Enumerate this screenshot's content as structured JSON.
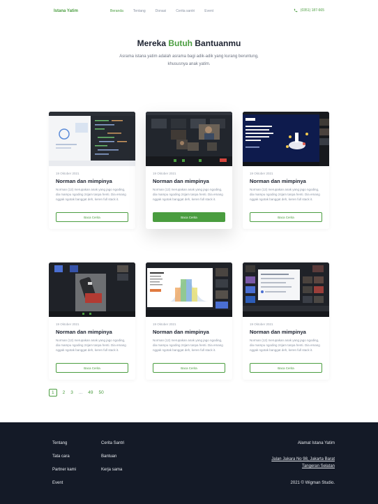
{
  "nav": {
    "brand": "Istana Yatim",
    "items": [
      {
        "label": "Beranda",
        "active": true
      },
      {
        "label": "Tentang",
        "active": false
      },
      {
        "label": "Donasi",
        "active": false
      },
      {
        "label": "Cerita santri",
        "active": false
      },
      {
        "label": "Event",
        "active": false
      }
    ],
    "phone_icon": "phone-icon",
    "phone": "(0351) 187-665"
  },
  "hero": {
    "title_pre": "Mereka",
    "title_accent": "Butuh",
    "title_post": "Bantuanmu",
    "description": "Asrama istana yatim adalah asrama bagi adik-adik yang kurang beruntung, khususnya anak yatim."
  },
  "cards": [
    {
      "date": "19 Oktober 2021",
      "title": "Norman dan mimpinya",
      "text": "Norman (12) merupakan anak yang jago ngoding, dia mampu ngoding 24jam tanpa henti. Dia emang nggak ngotak banggat deh, keren full stack it.",
      "button": "Baca Cerita",
      "primary": false,
      "image": "code-editor-screenshot"
    },
    {
      "date": "19 Oktober 2021",
      "title": "Norman dan mimpinya",
      "text": "Norman (12) merupakan anak yang jago ngoding, dia mampu ngoding 24jam tanpa henti. Dia emang nggak ngotak banggat deh, keren full stack it.",
      "button": "Baca Cerita",
      "primary": true,
      "image": "video-call-screenshot"
    },
    {
      "date": "19 Oktober 2021",
      "title": "Norman dan mimpinya",
      "text": "Norman (12) merupakan anak yang jago ngoding, dia mampu ngoding 24jam tanpa henti. Dia emang nggak ngotak banggat deh, keren full stack it.",
      "button": "Baca Cerita",
      "primary": false,
      "image": "presentation-slide-screenshot"
    },
    {
      "date": "19 Oktober 2021",
      "title": "Norman dan mimpinya",
      "text": "Norman (12) merupakan anak yang jago ngoding, dia mampu ngoding 24jam tanpa henti. Dia emang nggak ngotak banggat deh, keren full stack it.",
      "button": "Baca Cerita",
      "primary": false,
      "image": "video-call-device-screenshot"
    },
    {
      "date": "19 Oktober 2021",
      "title": "Norman dan mimpinya",
      "text": "Norman (12) merupakan anak yang jago ngoding, dia mampu ngoding 24jam tanpa henti. Dia emang nggak ngotak banggat deh, keren full stack it.",
      "button": "Baca Cerita",
      "primary": false,
      "image": "slide-share-screenshot"
    },
    {
      "date": "19 Oktober 2021",
      "title": "Norman dan mimpinya",
      "text": "Norman (12) merupakan anak yang jago ngoding, dia mampu ngoding 24jam tanpa henti. Dia emang nggak ngotak banggat deh, keren full stack it.",
      "button": "Baca Cerita",
      "primary": false,
      "image": "video-call-chat-screenshot"
    }
  ],
  "pagination": {
    "pages": [
      "1",
      "2",
      "3",
      "...",
      "49",
      "50"
    ],
    "current": "1"
  },
  "footer": {
    "col1": [
      "Tentang",
      "Tata cara",
      "Partner kami",
      "Event"
    ],
    "col2": [
      "Cerita Santri",
      "Bantuan",
      "Kerja sama"
    ],
    "address_title": "Alamat Istana Yatim",
    "address_line1": "Jalan Jakara No 98, Jakarta Barat",
    "address_line2": "Tangeran Selatan",
    "copyright": "2021 © Wigman Studio."
  },
  "colors": {
    "accent": "#4a9d3f",
    "footer_bg": "#141a27",
    "text_dark": "#1c2230",
    "text_muted": "#8a93a3"
  }
}
